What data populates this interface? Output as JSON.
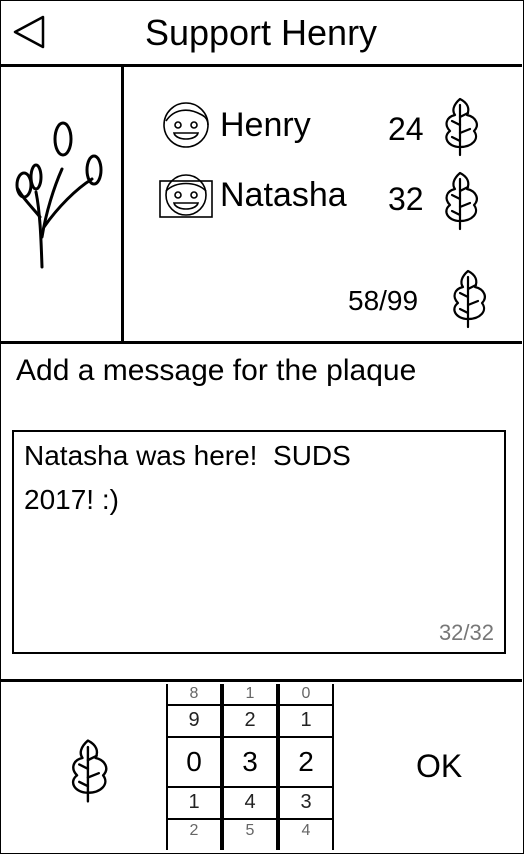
{
  "header": {
    "title": "Support Henry",
    "back_icon": "back-triangle-icon"
  },
  "supporters": [
    {
      "name": "Henry",
      "count": "24"
    },
    {
      "name": "Natasha",
      "count": "32"
    }
  ],
  "total": "58/99",
  "message": {
    "label": "Add a message for the plaque",
    "text": "Natasha was here!  SUDS\n2017! :)",
    "counter": "32/32"
  },
  "picker": {
    "columns": [
      [
        "8",
        "9",
        "0",
        "1",
        "2"
      ],
      [
        "1",
        "2",
        "3",
        "4",
        "5"
      ],
      [
        "0",
        "1",
        "2",
        "3",
        "4"
      ]
    ]
  },
  "ok_label": "OK"
}
